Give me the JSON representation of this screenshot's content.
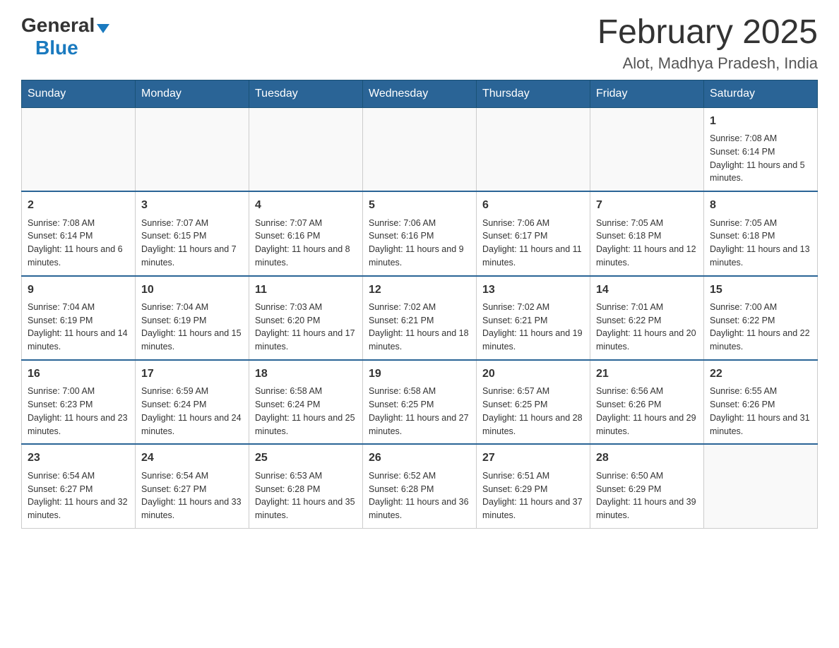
{
  "logo": {
    "general": "General",
    "blue": "Blue"
  },
  "title": "February 2025",
  "location": "Alot, Madhya Pradesh, India",
  "days_of_week": [
    "Sunday",
    "Monday",
    "Tuesday",
    "Wednesday",
    "Thursday",
    "Friday",
    "Saturday"
  ],
  "weeks": [
    [
      {
        "day": "",
        "info": ""
      },
      {
        "day": "",
        "info": ""
      },
      {
        "day": "",
        "info": ""
      },
      {
        "day": "",
        "info": ""
      },
      {
        "day": "",
        "info": ""
      },
      {
        "day": "",
        "info": ""
      },
      {
        "day": "1",
        "info": "Sunrise: 7:08 AM\nSunset: 6:14 PM\nDaylight: 11 hours and 5 minutes."
      }
    ],
    [
      {
        "day": "2",
        "info": "Sunrise: 7:08 AM\nSunset: 6:14 PM\nDaylight: 11 hours and 6 minutes."
      },
      {
        "day": "3",
        "info": "Sunrise: 7:07 AM\nSunset: 6:15 PM\nDaylight: 11 hours and 7 minutes."
      },
      {
        "day": "4",
        "info": "Sunrise: 7:07 AM\nSunset: 6:16 PM\nDaylight: 11 hours and 8 minutes."
      },
      {
        "day": "5",
        "info": "Sunrise: 7:06 AM\nSunset: 6:16 PM\nDaylight: 11 hours and 9 minutes."
      },
      {
        "day": "6",
        "info": "Sunrise: 7:06 AM\nSunset: 6:17 PM\nDaylight: 11 hours and 11 minutes."
      },
      {
        "day": "7",
        "info": "Sunrise: 7:05 AM\nSunset: 6:18 PM\nDaylight: 11 hours and 12 minutes."
      },
      {
        "day": "8",
        "info": "Sunrise: 7:05 AM\nSunset: 6:18 PM\nDaylight: 11 hours and 13 minutes."
      }
    ],
    [
      {
        "day": "9",
        "info": "Sunrise: 7:04 AM\nSunset: 6:19 PM\nDaylight: 11 hours and 14 minutes."
      },
      {
        "day": "10",
        "info": "Sunrise: 7:04 AM\nSunset: 6:19 PM\nDaylight: 11 hours and 15 minutes."
      },
      {
        "day": "11",
        "info": "Sunrise: 7:03 AM\nSunset: 6:20 PM\nDaylight: 11 hours and 17 minutes."
      },
      {
        "day": "12",
        "info": "Sunrise: 7:02 AM\nSunset: 6:21 PM\nDaylight: 11 hours and 18 minutes."
      },
      {
        "day": "13",
        "info": "Sunrise: 7:02 AM\nSunset: 6:21 PM\nDaylight: 11 hours and 19 minutes."
      },
      {
        "day": "14",
        "info": "Sunrise: 7:01 AM\nSunset: 6:22 PM\nDaylight: 11 hours and 20 minutes."
      },
      {
        "day": "15",
        "info": "Sunrise: 7:00 AM\nSunset: 6:22 PM\nDaylight: 11 hours and 22 minutes."
      }
    ],
    [
      {
        "day": "16",
        "info": "Sunrise: 7:00 AM\nSunset: 6:23 PM\nDaylight: 11 hours and 23 minutes."
      },
      {
        "day": "17",
        "info": "Sunrise: 6:59 AM\nSunset: 6:24 PM\nDaylight: 11 hours and 24 minutes."
      },
      {
        "day": "18",
        "info": "Sunrise: 6:58 AM\nSunset: 6:24 PM\nDaylight: 11 hours and 25 minutes."
      },
      {
        "day": "19",
        "info": "Sunrise: 6:58 AM\nSunset: 6:25 PM\nDaylight: 11 hours and 27 minutes."
      },
      {
        "day": "20",
        "info": "Sunrise: 6:57 AM\nSunset: 6:25 PM\nDaylight: 11 hours and 28 minutes."
      },
      {
        "day": "21",
        "info": "Sunrise: 6:56 AM\nSunset: 6:26 PM\nDaylight: 11 hours and 29 minutes."
      },
      {
        "day": "22",
        "info": "Sunrise: 6:55 AM\nSunset: 6:26 PM\nDaylight: 11 hours and 31 minutes."
      }
    ],
    [
      {
        "day": "23",
        "info": "Sunrise: 6:54 AM\nSunset: 6:27 PM\nDaylight: 11 hours and 32 minutes."
      },
      {
        "day": "24",
        "info": "Sunrise: 6:54 AM\nSunset: 6:27 PM\nDaylight: 11 hours and 33 minutes."
      },
      {
        "day": "25",
        "info": "Sunrise: 6:53 AM\nSunset: 6:28 PM\nDaylight: 11 hours and 35 minutes."
      },
      {
        "day": "26",
        "info": "Sunrise: 6:52 AM\nSunset: 6:28 PM\nDaylight: 11 hours and 36 minutes."
      },
      {
        "day": "27",
        "info": "Sunrise: 6:51 AM\nSunset: 6:29 PM\nDaylight: 11 hours and 37 minutes."
      },
      {
        "day": "28",
        "info": "Sunrise: 6:50 AM\nSunset: 6:29 PM\nDaylight: 11 hours and 39 minutes."
      },
      {
        "day": "",
        "info": ""
      }
    ]
  ]
}
